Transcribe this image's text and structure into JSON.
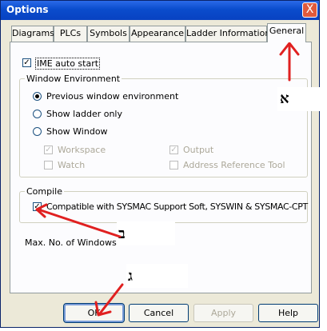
{
  "window": {
    "title": "Options",
    "close_glyph": "X"
  },
  "tabs": [
    {
      "label": "Diagrams"
    },
    {
      "label": "PLCs"
    },
    {
      "label": "Symbols"
    },
    {
      "label": "Appearance"
    },
    {
      "label": "Ladder Information"
    },
    {
      "label": "General",
      "active": true
    }
  ],
  "general": {
    "ime_auto_start": {
      "label": "IME auto start",
      "checked": true
    },
    "window_environment": {
      "legend": "Window Environment",
      "options": [
        {
          "label": "Previous window environment",
          "selected": true
        },
        {
          "label": "Show ladder only",
          "selected": false
        },
        {
          "label": "Show Window",
          "selected": false
        }
      ],
      "sub_options": [
        {
          "label": "Workspace",
          "checked": true,
          "enabled": false
        },
        {
          "label": "Output",
          "checked": true,
          "enabled": false
        },
        {
          "label": "Watch",
          "checked": false,
          "enabled": false
        },
        {
          "label": "Address Reference Tool",
          "checked": false,
          "enabled": false
        }
      ]
    },
    "compile": {
      "legend": "Compile",
      "compatible": {
        "label": "Compatible with SYSMAC Support Soft, SYSWIN & SYSMAC-CPT",
        "checked": true
      }
    },
    "max_windows": {
      "label": "Max. No. of Windows:"
    }
  },
  "buttons": {
    "ok": "OK",
    "cancel": "Cancel",
    "apply": "Apply",
    "help": "Help"
  },
  "annotations": {
    "alef": "א",
    "bet": "ב",
    "gimel": "ג",
    "arrow_color": "#e02020"
  },
  "check_glyph": "✓"
}
